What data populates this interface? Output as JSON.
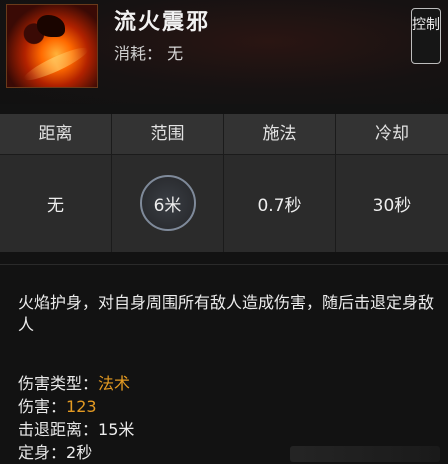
{
  "skill": {
    "name": "流火震邪",
    "cost_label": "消耗：",
    "cost_value": "无",
    "tag": "控制",
    "icon": "fire-skill-icon"
  },
  "stats": {
    "headers": [
      "距离",
      "范围",
      "施法",
      "冷却"
    ],
    "values": [
      "无",
      "6米",
      "0.7秒",
      "30秒"
    ]
  },
  "description": "火焰护身，对自身周围所有敌人造成伤害，随后击退定身敌人",
  "attributes": [
    {
      "label": "伤害类型：",
      "value": "法术",
      "color": "#e39a22"
    },
    {
      "label": "伤害：",
      "value": "123",
      "color": "#e39a22"
    },
    {
      "label": "击退距离：",
      "value": "15米",
      "color": "#ececec"
    },
    {
      "label": "定身：",
      "value": "2秒",
      "color": "#ececec"
    }
  ],
  "colors": {
    "accent_orange": "#e39a22",
    "panel": "#2b2b2b",
    "background": "#121212"
  }
}
